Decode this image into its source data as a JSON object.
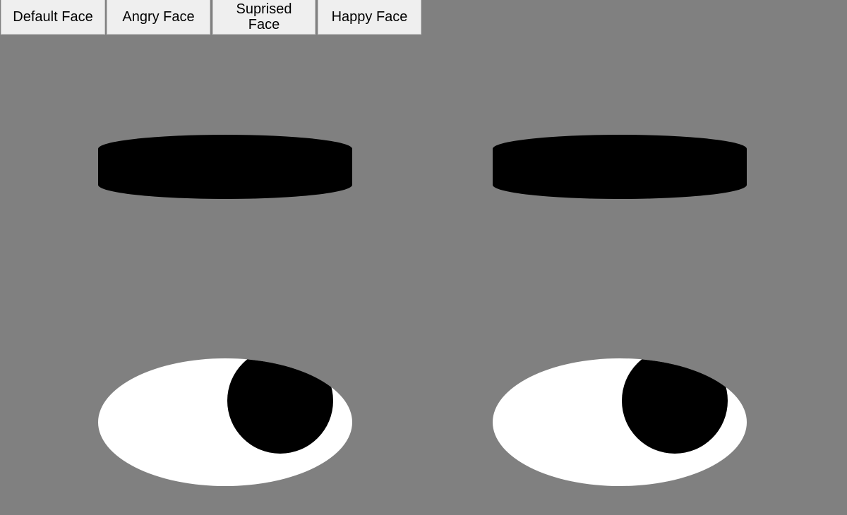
{
  "toolbar": {
    "buttons": [
      {
        "label": "Default Face"
      },
      {
        "label": "Angry Face"
      },
      {
        "label": "Suprised Face"
      },
      {
        "label": "Happy Face"
      }
    ]
  },
  "colors": {
    "background": "#808080",
    "button_bg": "#efefef",
    "brow": "#000000",
    "eye_white": "#ffffff",
    "pupil": "#000000"
  }
}
